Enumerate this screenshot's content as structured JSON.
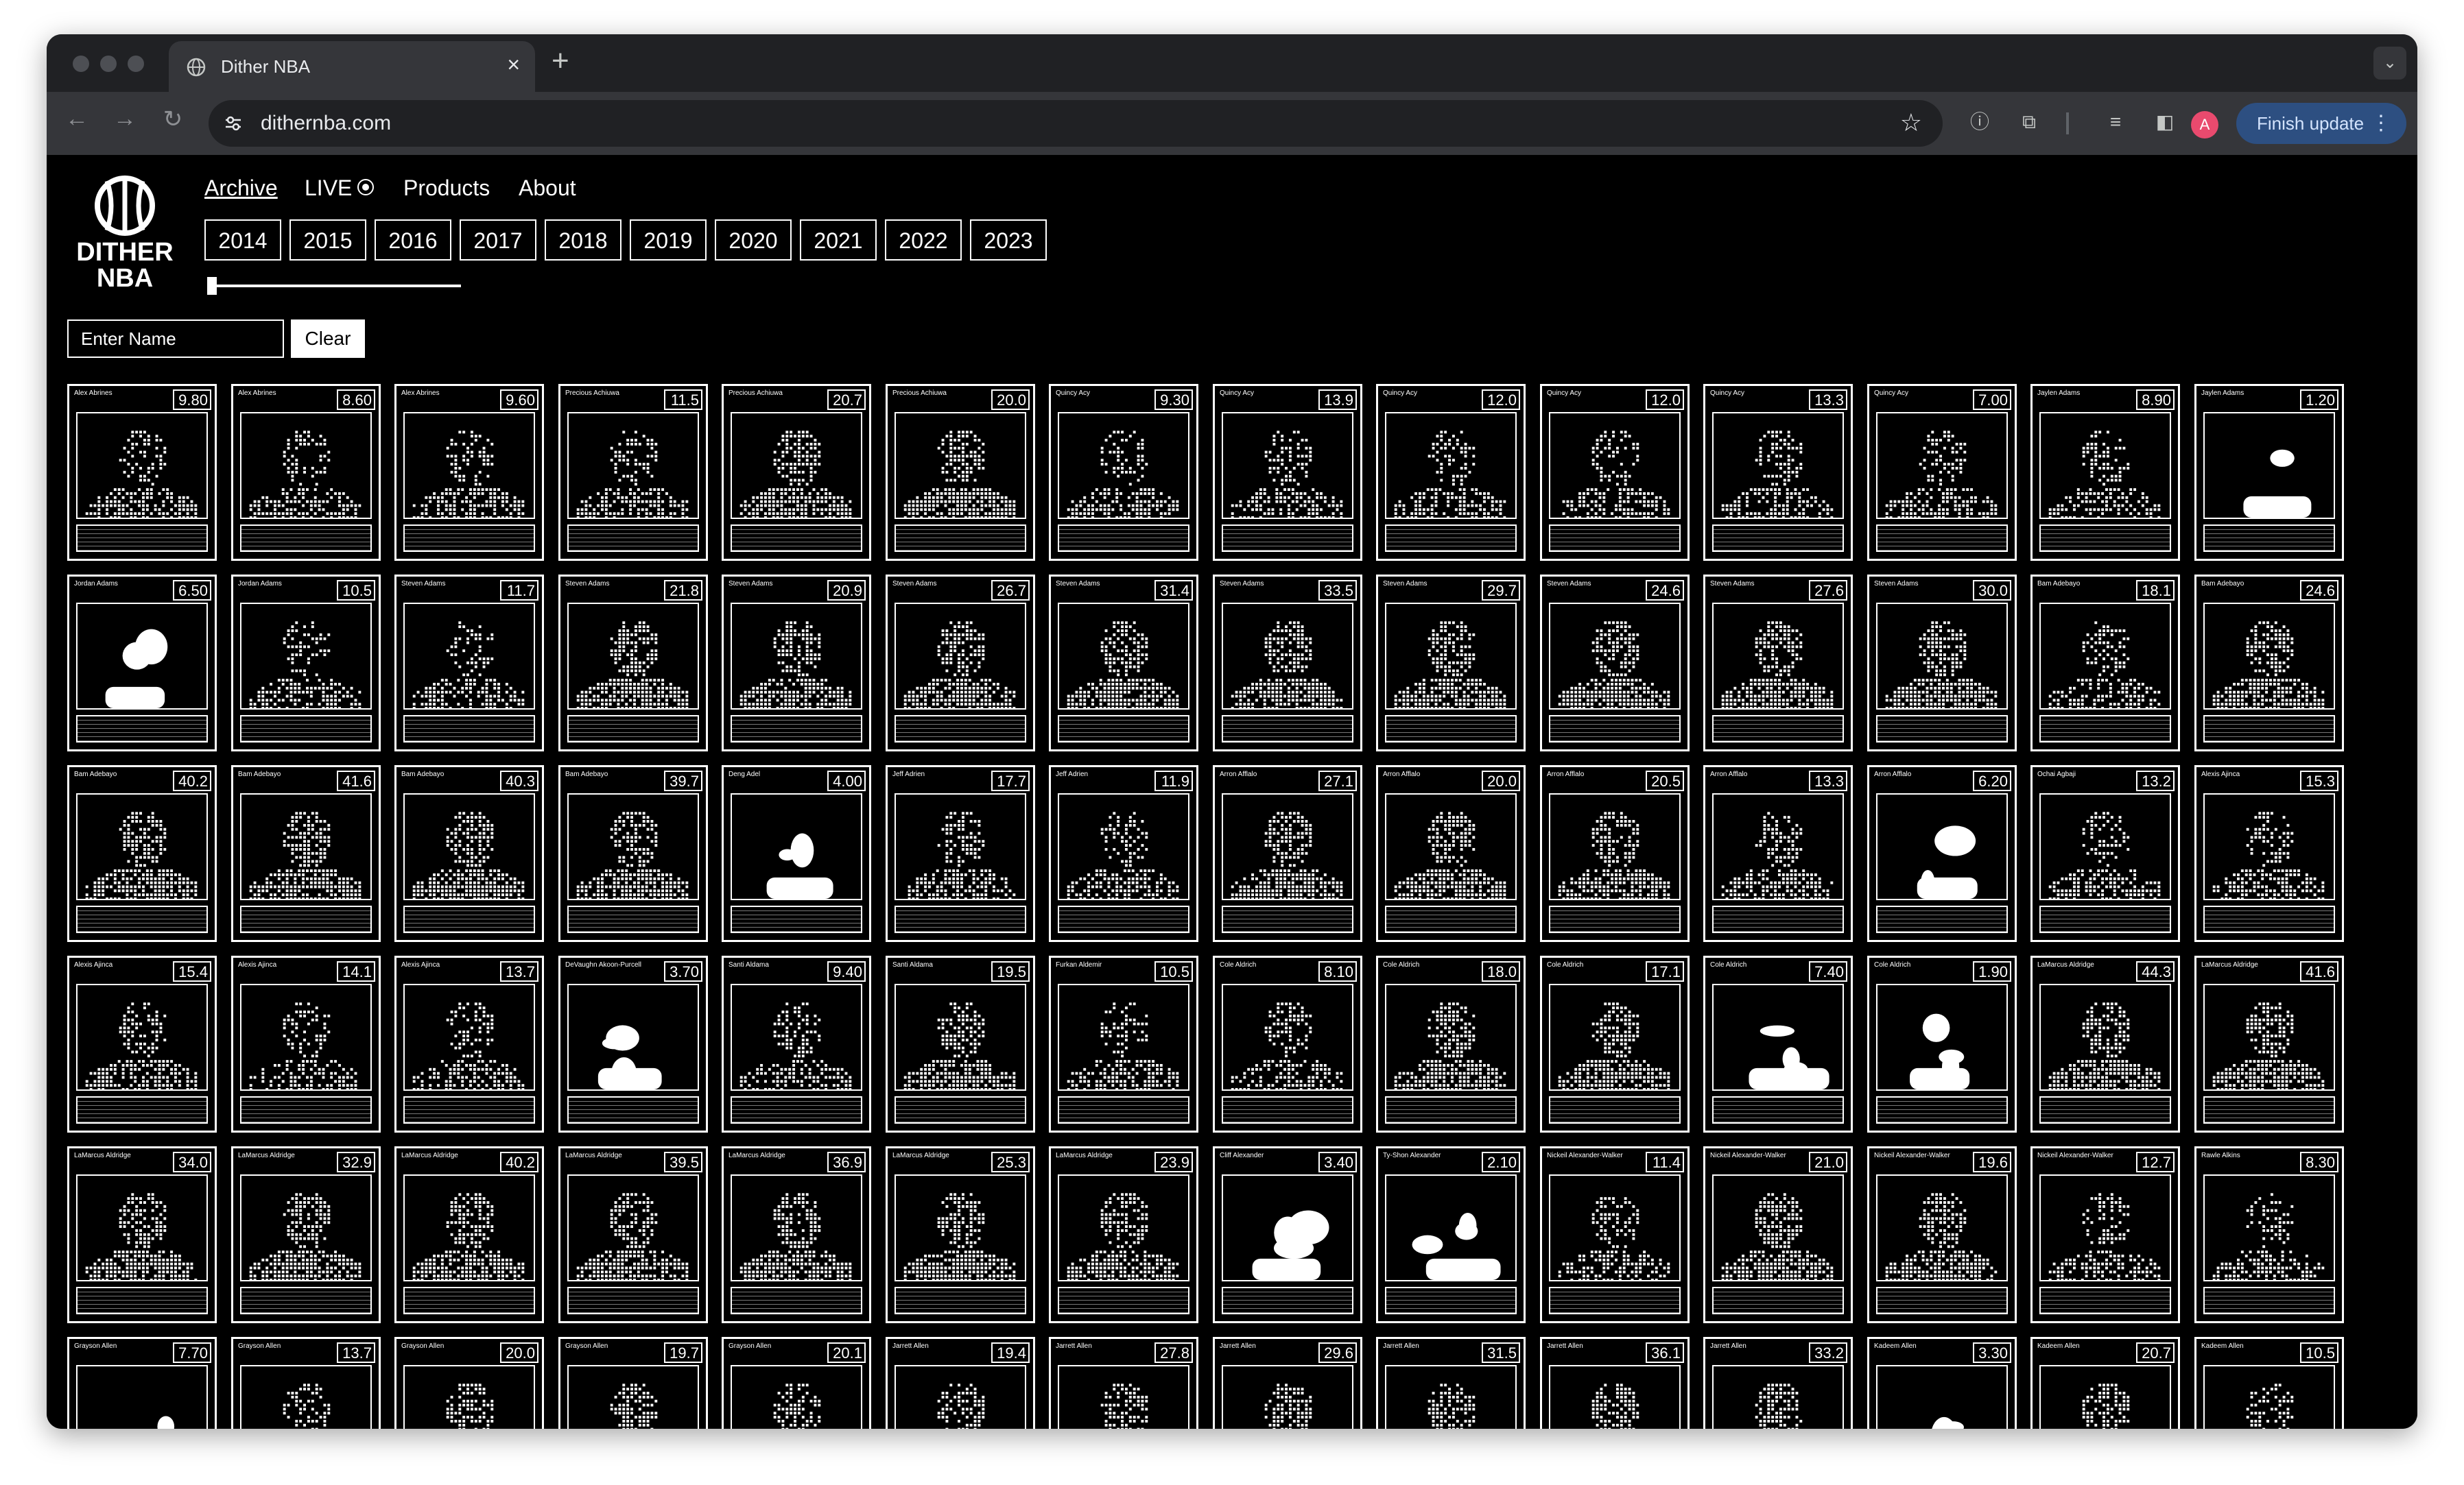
{
  "browser": {
    "tab_title": "Dither NBA",
    "new_tab_symbol": "+",
    "close_symbol": "×",
    "url": "dithernba.com",
    "profile_initial": "A",
    "update_label": "Finish update"
  },
  "site": {
    "logo_line1": "DITHER",
    "logo_line2": "NBA",
    "nav": {
      "archive": "Archive",
      "live": "LIVE",
      "products": "Products",
      "about": "About"
    },
    "years": [
      "2014",
      "2015",
      "2016",
      "2017",
      "2018",
      "2019",
      "2020",
      "2021",
      "2022",
      "2023"
    ],
    "search": {
      "placeholder": "Enter Name",
      "clear_label": "Clear"
    }
  },
  "cards": [
    {
      "name": "Alex Abrines",
      "score": "9.80",
      "style": "sparse"
    },
    {
      "name": "Alex Abrines",
      "score": "8.60",
      "style": "sparse"
    },
    {
      "name": "Alex Abrines",
      "score": "9.60",
      "style": "sparse"
    },
    {
      "name": "Precious Achiuwa",
      "score": "11.5",
      "style": "sparse"
    },
    {
      "name": "Precious Achiuwa",
      "score": "20.7",
      "style": "dense"
    },
    {
      "name": "Precious Achiuwa",
      "score": "20.0",
      "style": "dense"
    },
    {
      "name": "Quincy Acy",
      "score": "9.30",
      "style": "sparse"
    },
    {
      "name": "Quincy Acy",
      "score": "13.9",
      "style": "sparse"
    },
    {
      "name": "Quincy Acy",
      "score": "12.0",
      "style": "sparse"
    },
    {
      "name": "Quincy Acy",
      "score": "12.0",
      "style": "sparse"
    },
    {
      "name": "Quincy Acy",
      "score": "13.3",
      "style": "sparse"
    },
    {
      "name": "Quincy Acy",
      "score": "7.00",
      "style": "sparse"
    },
    {
      "name": "Jaylen Adams",
      "score": "8.90",
      "style": "sparse"
    },
    {
      "name": "Jaylen Adams",
      "score": "1.20",
      "style": "blob"
    },
    {
      "name": "Jordan Adams",
      "score": "6.50",
      "style": "blob"
    },
    {
      "name": "Jordan Adams",
      "score": "10.5",
      "style": "sparse"
    },
    {
      "name": "Steven Adams",
      "score": "11.7",
      "style": "sparse"
    },
    {
      "name": "Steven Adams",
      "score": "21.8",
      "style": "dense"
    },
    {
      "name": "Steven Adams",
      "score": "20.9",
      "style": "dense"
    },
    {
      "name": "Steven Adams",
      "score": "26.7",
      "style": "dense"
    },
    {
      "name": "Steven Adams",
      "score": "31.4",
      "style": "dense"
    },
    {
      "name": "Steven Adams",
      "score": "33.5",
      "style": "dense"
    },
    {
      "name": "Steven Adams",
      "score": "29.7",
      "style": "dense"
    },
    {
      "name": "Steven Adams",
      "score": "24.6",
      "style": "dense"
    },
    {
      "name": "Steven Adams",
      "score": "27.6",
      "style": "dense"
    },
    {
      "name": "Steven Adams",
      "score": "30.0",
      "style": "dense"
    },
    {
      "name": "Bam Adebayo",
      "score": "18.1",
      "style": "sparse"
    },
    {
      "name": "Bam Adebayo",
      "score": "24.6",
      "style": "dense"
    },
    {
      "name": "Bam Adebayo",
      "score": "40.2",
      "style": "dense"
    },
    {
      "name": "Bam Adebayo",
      "score": "41.6",
      "style": "dense"
    },
    {
      "name": "Bam Adebayo",
      "score": "40.3",
      "style": "dense"
    },
    {
      "name": "Bam Adebayo",
      "score": "39.7",
      "style": "dense"
    },
    {
      "name": "Deng Adel",
      "score": "4.00",
      "style": "blob"
    },
    {
      "name": "Jeff Adrien",
      "score": "17.7",
      "style": "sparse"
    },
    {
      "name": "Jeff Adrien",
      "score": "11.9",
      "style": "sparse"
    },
    {
      "name": "Arron Afflalo",
      "score": "27.1",
      "style": "dense"
    },
    {
      "name": "Arron Afflalo",
      "score": "20.0",
      "style": "dense"
    },
    {
      "name": "Arron Afflalo",
      "score": "20.5",
      "style": "dense"
    },
    {
      "name": "Arron Afflalo",
      "score": "13.3",
      "style": "sparse"
    },
    {
      "name": "Arron Afflalo",
      "score": "6.20",
      "style": "blob"
    },
    {
      "name": "Ochai Agbaji",
      "score": "13.2",
      "style": "sparse"
    },
    {
      "name": "Alexis Ajinca",
      "score": "15.3",
      "style": "sparse"
    },
    {
      "name": "Alexis Ajinca",
      "score": "15.4",
      "style": "sparse"
    },
    {
      "name": "Alexis Ajinca",
      "score": "14.1",
      "style": "sparse"
    },
    {
      "name": "Alexis Ajinca",
      "score": "13.7",
      "style": "sparse"
    },
    {
      "name": "DeVaughn Akoon-Purcell",
      "score": "3.70",
      "style": "blob"
    },
    {
      "name": "Santi Aldama",
      "score": "9.40",
      "style": "sparse"
    },
    {
      "name": "Santi Aldama",
      "score": "19.5",
      "style": "dense"
    },
    {
      "name": "Furkan Aldemir",
      "score": "10.5",
      "style": "sparse"
    },
    {
      "name": "Cole Aldrich",
      "score": "8.10",
      "style": "sparse"
    },
    {
      "name": "Cole Aldrich",
      "score": "18.0",
      "style": "dense"
    },
    {
      "name": "Cole Aldrich",
      "score": "17.1",
      "style": "dense"
    },
    {
      "name": "Cole Aldrich",
      "score": "7.40",
      "style": "blob"
    },
    {
      "name": "Cole Aldrich",
      "score": "1.90",
      "style": "blob"
    },
    {
      "name": "LaMarcus Aldridge",
      "score": "44.3",
      "style": "dense"
    },
    {
      "name": "LaMarcus Aldridge",
      "score": "41.6",
      "style": "dense"
    },
    {
      "name": "LaMarcus Aldridge",
      "score": "34.0",
      "style": "dense"
    },
    {
      "name": "LaMarcus Aldridge",
      "score": "32.9",
      "style": "dense"
    },
    {
      "name": "LaMarcus Aldridge",
      "score": "40.2",
      "style": "dense"
    },
    {
      "name": "LaMarcus Aldridge",
      "score": "39.5",
      "style": "dense"
    },
    {
      "name": "LaMarcus Aldridge",
      "score": "36.9",
      "style": "dense"
    },
    {
      "name": "LaMarcus Aldridge",
      "score": "25.3",
      "style": "dense"
    },
    {
      "name": "LaMarcus Aldridge",
      "score": "23.9",
      "style": "dense"
    },
    {
      "name": "Cliff Alexander",
      "score": "3.40",
      "style": "blob"
    },
    {
      "name": "Ty-Shon Alexander",
      "score": "2.10",
      "style": "blob"
    },
    {
      "name": "Nickeil Alexander-Walker",
      "score": "11.4",
      "style": "sparse"
    },
    {
      "name": "Nickeil Alexander-Walker",
      "score": "21.0",
      "style": "dense"
    },
    {
      "name": "Nickeil Alexander-Walker",
      "score": "19.6",
      "style": "dense"
    },
    {
      "name": "Nickeil Alexander-Walker",
      "score": "12.7",
      "style": "sparse"
    },
    {
      "name": "Rawle Alkins",
      "score": "8.30",
      "style": "sparse"
    },
    {
      "name": "Grayson Allen",
      "score": "7.70",
      "style": "blob"
    },
    {
      "name": "Grayson Allen",
      "score": "13.7",
      "style": "sparse"
    },
    {
      "name": "Grayson Allen",
      "score": "20.0",
      "style": "dense"
    },
    {
      "name": "Grayson Allen",
      "score": "19.7",
      "style": "dense"
    },
    {
      "name": "Grayson Allen",
      "score": "20.1",
      "style": "dense"
    },
    {
      "name": "Jarrett Allen",
      "score": "19.4",
      "style": "dense"
    },
    {
      "name": "Jarrett Allen",
      "score": "27.8",
      "style": "dense"
    },
    {
      "name": "Jarrett Allen",
      "score": "29.6",
      "style": "dense"
    },
    {
      "name": "Jarrett Allen",
      "score": "31.5",
      "style": "dense"
    },
    {
      "name": "Jarrett Allen",
      "score": "36.1",
      "style": "dense"
    },
    {
      "name": "Jarrett Allen",
      "score": "33.2",
      "style": "dense"
    },
    {
      "name": "Kadeem Allen",
      "score": "3.30",
      "style": "blob"
    },
    {
      "name": "Kadeem Allen",
      "score": "20.7",
      "style": "dense"
    },
    {
      "name": "Kadeem Allen",
      "score": "10.5",
      "style": "sparse"
    }
  ]
}
